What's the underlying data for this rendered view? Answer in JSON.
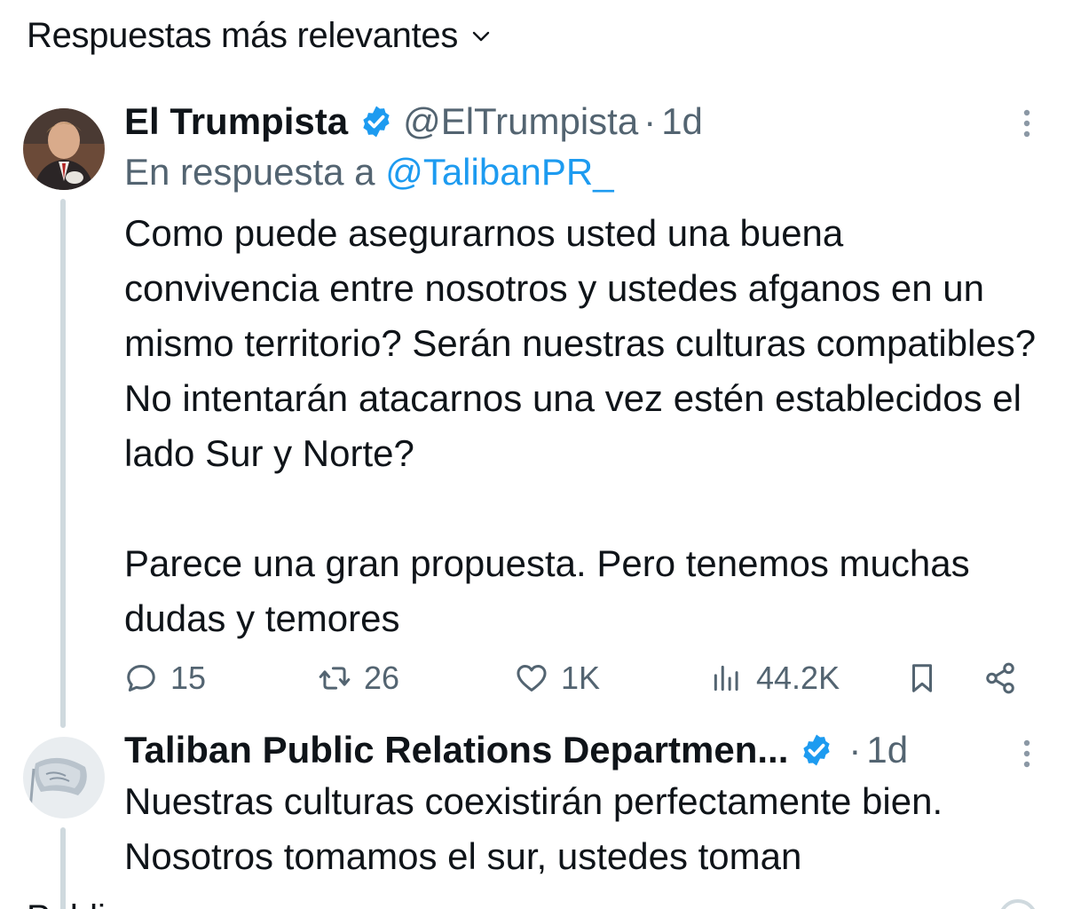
{
  "sort": {
    "label": "Respuestas más relevantes"
  },
  "tweets": [
    {
      "display_name": "El Trumpista",
      "handle": "@ElTrumpista",
      "separator": "·",
      "age": "1d",
      "reply_prefix": "En respuesta a",
      "reply_mention": "@TalibanPR_",
      "text_p1": "Como puede asegurarnos usted una buena convivencia entre nosotros y ustedes afganos en un mismo territorio? Serán nuestras culturas compatibles? No intentarán atacarnos una vez estén establecidos el lado Sur y Norte?",
      "text_p2": "Parece una gran propuesta. Pero tenemos muchas dudas y temores",
      "stats": {
        "replies": "15",
        "retweets": "26",
        "likes": "1K",
        "views": "44.2K"
      }
    },
    {
      "display_name": "Taliban Public Relations Departmen...",
      "separator": "·",
      "age": "1d",
      "text_p1": "Nuestras culturas coexistirán perfectamente bien. Nosotros tomamos el sur, ustedes toman"
    }
  ],
  "bottom": {
    "partial_label": "Publi"
  },
  "colors": {
    "accent": "#1d9bf0",
    "secondary_text": "#536471",
    "thread_line": "#cfd9de"
  },
  "icons": [
    "chevron-down-icon",
    "verified-badge-icon",
    "more-icon",
    "reply-icon",
    "retweet-icon",
    "like-icon",
    "views-icon",
    "bookmark-icon",
    "share-icon"
  ]
}
